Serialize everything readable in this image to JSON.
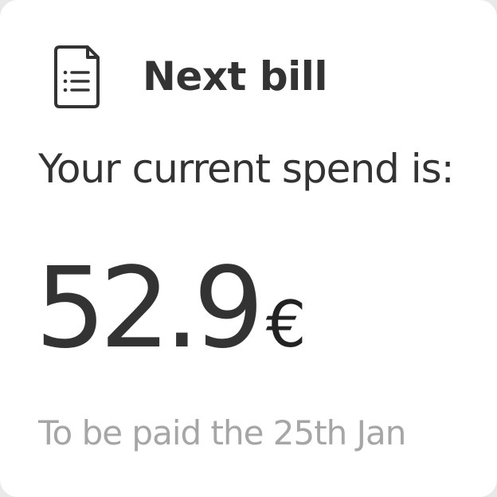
{
  "card": {
    "icon": "document-list-icon",
    "title": "Next bill",
    "subtitle": "Your current spend is:",
    "amount": "52.9",
    "currency": "€",
    "due_text": "To be paid the 25th Jan"
  },
  "colors": {
    "text": "#333333",
    "muted": "#a6a6a6",
    "background": "#ffffff"
  }
}
